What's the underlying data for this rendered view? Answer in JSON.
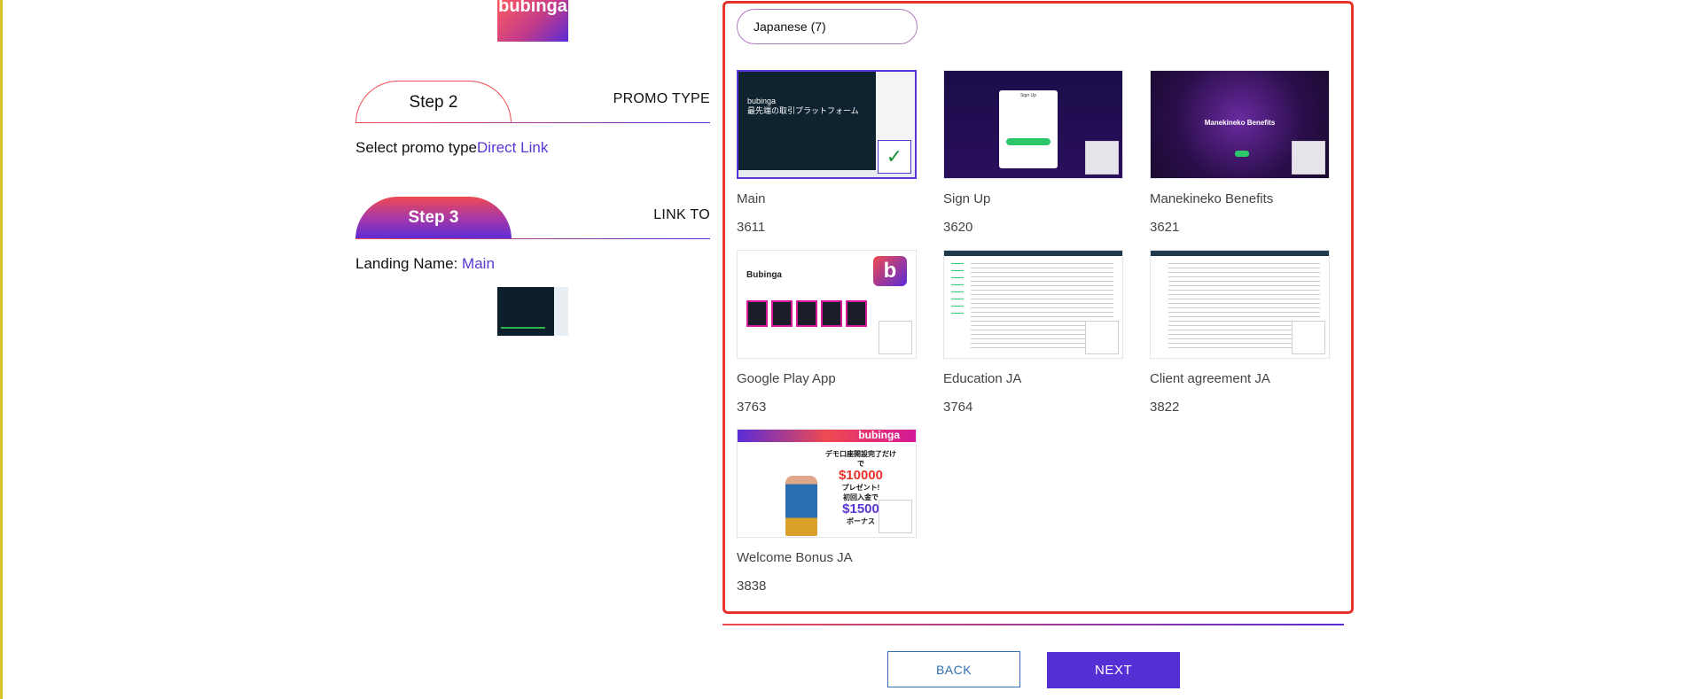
{
  "logo": {
    "text": "bubinga"
  },
  "steps": [
    {
      "label": "Step 2",
      "side_label": "PROMO TYPE"
    },
    {
      "label": "Step 3",
      "side_label": "LINK TO"
    }
  ],
  "promo_type": {
    "label": "Select promo type",
    "value": "Direct Link"
  },
  "landing": {
    "label": "Landing Name:",
    "value": "Main"
  },
  "language_filter": {
    "value": "Japanese (7)"
  },
  "landings": [
    {
      "name": "Main",
      "id": "3611",
      "selected": true
    },
    {
      "name": "Sign Up",
      "id": "3620",
      "selected": false
    },
    {
      "name": "Manekineko Benefits",
      "id": "3621",
      "selected": false
    },
    {
      "name": "Google Play App",
      "id": "3763",
      "selected": false
    },
    {
      "name": "Education JA",
      "id": "3764",
      "selected": false
    },
    {
      "name": "Client agreement JA",
      "id": "3822",
      "selected": false
    },
    {
      "name": "Welcome Bonus JA",
      "id": "3838",
      "selected": false
    }
  ],
  "thumb_text": {
    "main_headline": "最先端の取引プラットフォーム",
    "main_brand": "bubinga",
    "signup_title": "Sign Up",
    "mane_headline": "Manekineko Benefits",
    "gp_brand": "Bubinga",
    "gp_logo": "b",
    "bonus_brand": "bubinga",
    "bonus_line1": "デモ口座開設完了だけで",
    "bonus_amount1": "$10000",
    "bonus_line2": "プレゼント!",
    "bonus_line3": "初回入金で",
    "bonus_amount2": "$1500",
    "bonus_line4": "ボーナス"
  },
  "buttons": {
    "back": "BACK",
    "next": "NEXT"
  },
  "colors": {
    "accent": "#5430d4",
    "brand_red": "#ef4a50",
    "frame": "#e8322b",
    "back_border": "#2f6fb6"
  }
}
